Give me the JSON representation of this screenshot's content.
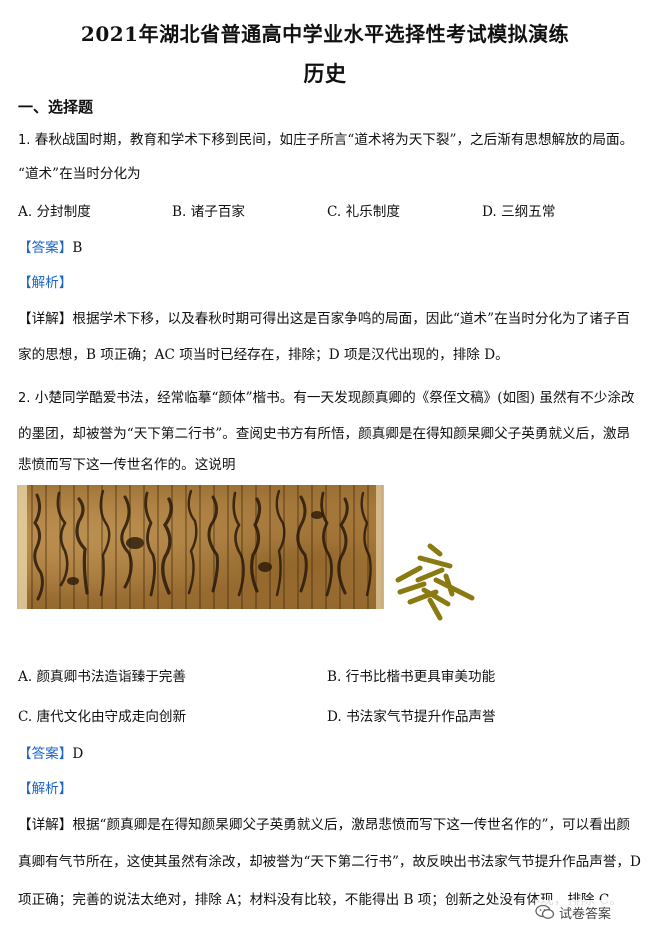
{
  "header": {
    "title": "2021年湖北省普通高中学业水平选择性考试模拟演练",
    "subject": "历史"
  },
  "section": "一、选择题",
  "q1": {
    "num": "1.",
    "line1": "春秋战国时期，教育和学术下移到民间，如庄子所言“道术将为天下裂”，之后渐有思想解放的局面。",
    "line2": "“道术”在当时分化为",
    "options": [
      {
        "key": "A.",
        "text": "分封制度"
      },
      {
        "key": "B.",
        "text": "诸子百家"
      },
      {
        "key": "C.",
        "text": "礼乐制度"
      },
      {
        "key": "D.",
        "text": "三纲五常"
      }
    ],
    "answer_tag": "【答案】",
    "answer": "B",
    "analysis_tag": "【解析】",
    "detail_tag": "【详解】",
    "detail1": "根据学术下移，以及春秋时期可得出这是百家争鸣的局面，因此“道术”在当时分化为了诸子百",
    "detail2": "家的思想，B 项正确；AC 项当时已经存在，排除；D 项是汉代出现的，排除 D。"
  },
  "q2": {
    "num": "2.",
    "line1": "小楚同学酷爱书法，经常临摹“颜体”楷书。有一天发现颜真卿的《祭侄文稿》(如图) 虽然有不少涂改",
    "line2": "的墨团，却被誉为“天下第二行书”。查阅史书方有所悟，颜真卿是在得知颜杲卿父子英勇就义后，激昂",
    "line3": "悲愤而写下这一传世名作的。这说明",
    "options": [
      {
        "key": "A.",
        "text": "颜真卿书法造诣臻于完善"
      },
      {
        "key": "B.",
        "text": "行书比楷书更具审美功能"
      },
      {
        "key": "C.",
        "text": "唐代文化由守成走向创新"
      },
      {
        "key": "D.",
        "text": "书法家气节提升作品声誉"
      }
    ],
    "answer_tag": "【答案】",
    "answer": "D",
    "analysis_tag": "【解析】",
    "detail_tag": "【详解】",
    "detail1": "根据“颜真卿是在得知颜杲卿父子英勇就义后，激昂悲愤而写下这一传世名作的”，可以看出颜",
    "detail2": "真卿有气节所在，这使其虽然有涂改，却被誉为“天下第二行书”，故反映出书法家气节提升作品声誉，D",
    "detail3": "项正确；完善的说法太绝对，排除 A；材料没有比较，不能得出 B 项；创新之处没有体现，排除 C。"
  },
  "watermark": {
    "text": "试卷答案",
    "icon": "wechat-icon"
  },
  "colors": {
    "tag": "#1d64c8",
    "callig": "#8a7a12"
  }
}
